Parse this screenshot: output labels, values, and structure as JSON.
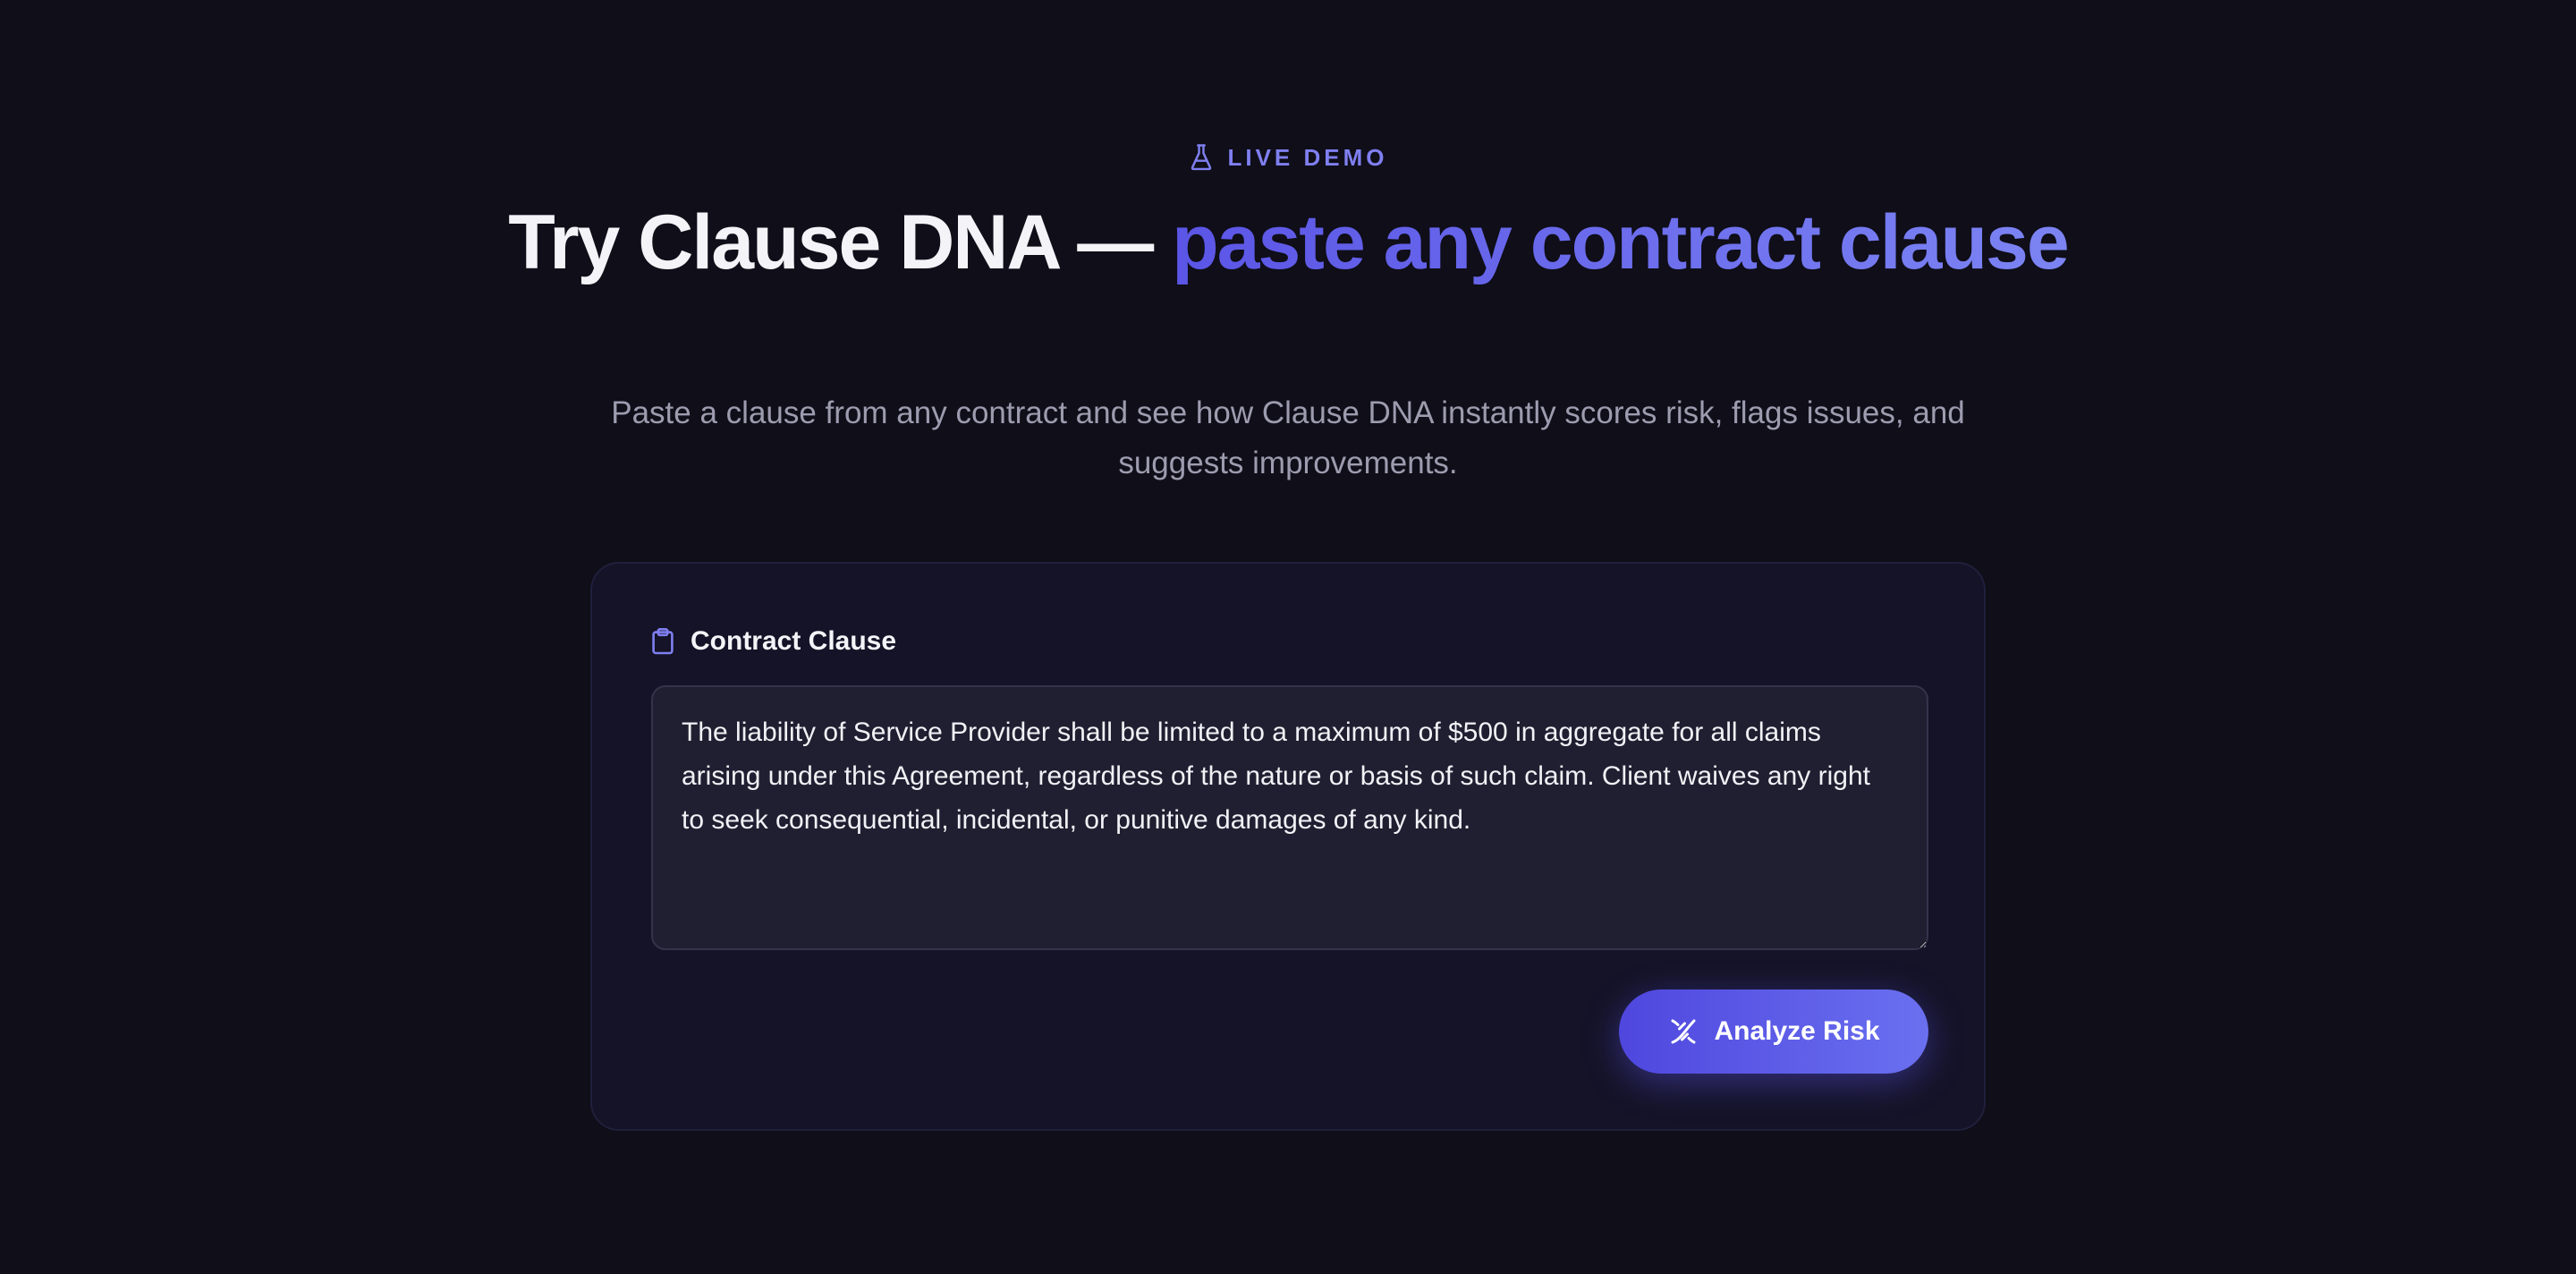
{
  "eyebrow": {
    "icon": "flask-icon",
    "text": "LIVE DEMO"
  },
  "headline": {
    "text": "Try Clause DNA — ",
    "accent": "paste any contract clause"
  },
  "subheading": "Paste a clause from any contract and see how Clause DNA instantly scores risk, flags issues, and suggests improvements.",
  "card": {
    "field_label": {
      "icon": "clipboard-icon",
      "text": "Contract Clause"
    },
    "textarea_value": "The liability of Service Provider shall be limited to a maximum of $500 in aggregate for all claims arising under this Agreement, regardless of the nature or basis of such claim. Client waives any right to seek consequential, incidental, or punitive damages of any kind.",
    "analyze_button": {
      "icon": "dna-icon",
      "label": "Analyze Risk"
    }
  },
  "colors": {
    "background": "#0f0e19",
    "accent": "#7f7ff1",
    "card": "#141327",
    "button_start": "#4f47de",
    "button_end": "#6a70f0"
  }
}
